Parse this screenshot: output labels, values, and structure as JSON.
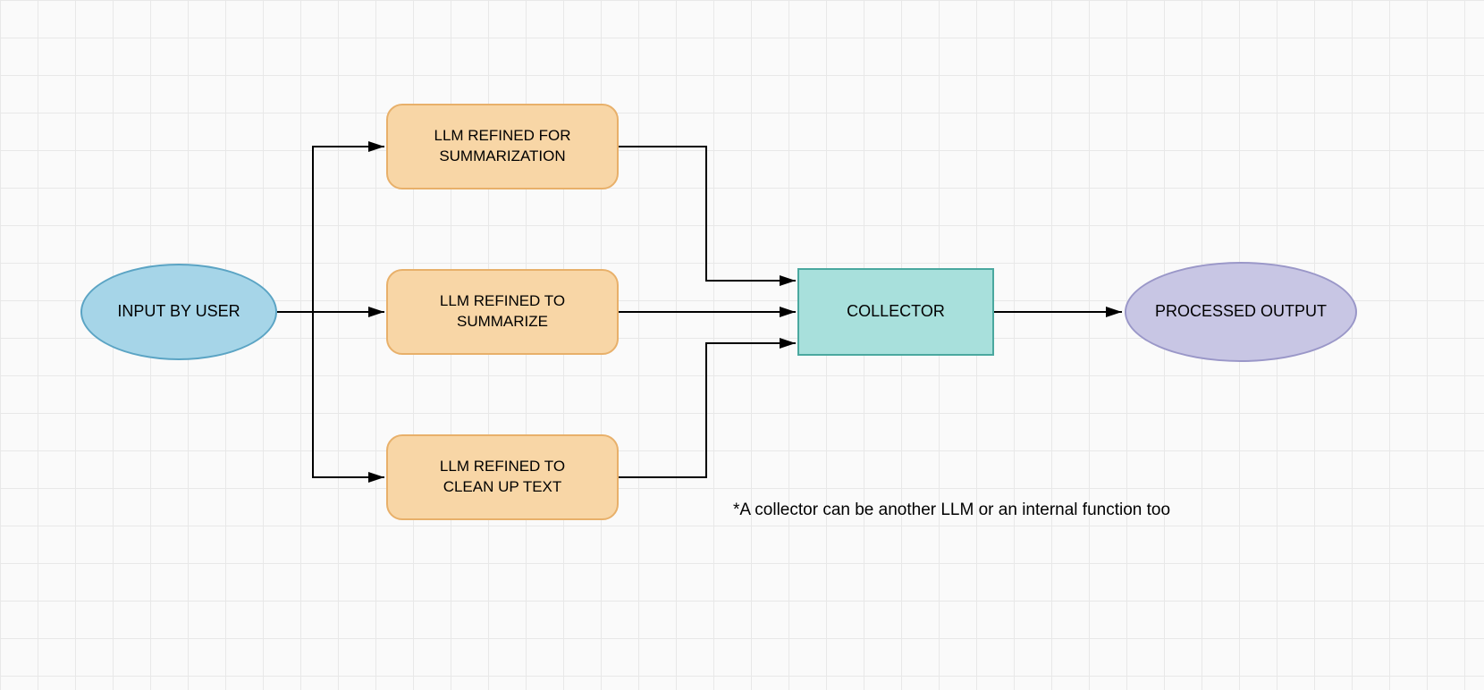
{
  "nodes": {
    "input": {
      "label": "INPUT BY USER",
      "fill": "#a6d5e8",
      "stroke": "#5ba4c4"
    },
    "llm1": {
      "line1": "LLM REFINED FOR",
      "line2": "SUMMARIZATION",
      "fill": "#f8d6a6",
      "stroke": "#e8b06a"
    },
    "llm2": {
      "line1": "LLM REFINED TO",
      "line2": "SUMMARIZE",
      "fill": "#f8d6a6",
      "stroke": "#e8b06a"
    },
    "llm3": {
      "line1": "LLM REFINED TO",
      "line2": "CLEAN UP TEXT",
      "fill": "#f8d6a6",
      "stroke": "#e8b06a"
    },
    "collector": {
      "label": "COLLECTOR",
      "fill": "#a8e0dc",
      "stroke": "#4aa89f"
    },
    "output": {
      "label": "PROCESSED OUTPUT",
      "fill": "#c8c6e4",
      "stroke": "#9a97c8"
    }
  },
  "note": "*A collector can be another LLM or an internal function too"
}
